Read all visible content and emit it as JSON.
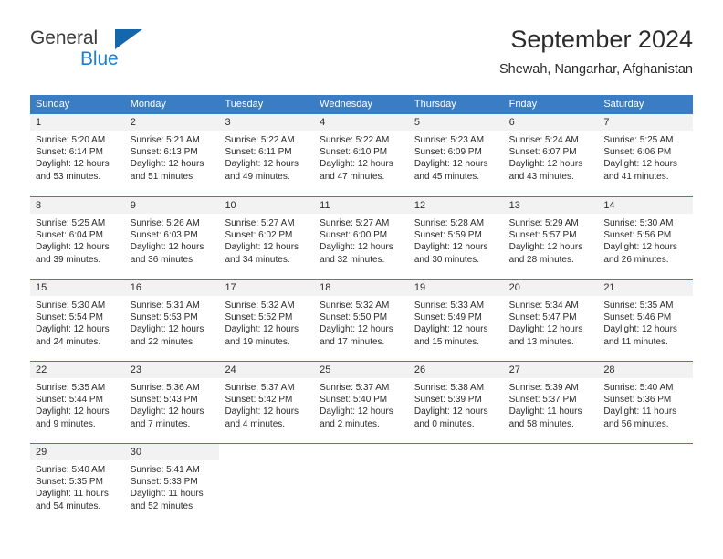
{
  "brand": {
    "name_part1": "General",
    "name_part2": "Blue",
    "logo_icon": "blue-triangle-logo"
  },
  "header": {
    "title": "September 2024",
    "location": "Shewah, Nangarhar, Afghanistan"
  },
  "colors": {
    "header_blue": "#3b7dc4",
    "brand_blue": "#1b7fd4",
    "day_number_bg": "#f2f2f2",
    "text": "#2b2b2b"
  },
  "weekdays": [
    "Sunday",
    "Monday",
    "Tuesday",
    "Wednesday",
    "Thursday",
    "Friday",
    "Saturday"
  ],
  "weeks": [
    {
      "days": [
        {
          "num": "1",
          "sunrise": "Sunrise: 5:20 AM",
          "sunset": "Sunset: 6:14 PM",
          "daylight1": "Daylight: 12 hours",
          "daylight2": "and 53 minutes."
        },
        {
          "num": "2",
          "sunrise": "Sunrise: 5:21 AM",
          "sunset": "Sunset: 6:13 PM",
          "daylight1": "Daylight: 12 hours",
          "daylight2": "and 51 minutes."
        },
        {
          "num": "3",
          "sunrise": "Sunrise: 5:22 AM",
          "sunset": "Sunset: 6:11 PM",
          "daylight1": "Daylight: 12 hours",
          "daylight2": "and 49 minutes."
        },
        {
          "num": "4",
          "sunrise": "Sunrise: 5:22 AM",
          "sunset": "Sunset: 6:10 PM",
          "daylight1": "Daylight: 12 hours",
          "daylight2": "and 47 minutes."
        },
        {
          "num": "5",
          "sunrise": "Sunrise: 5:23 AM",
          "sunset": "Sunset: 6:09 PM",
          "daylight1": "Daylight: 12 hours",
          "daylight2": "and 45 minutes."
        },
        {
          "num": "6",
          "sunrise": "Sunrise: 5:24 AM",
          "sunset": "Sunset: 6:07 PM",
          "daylight1": "Daylight: 12 hours",
          "daylight2": "and 43 minutes."
        },
        {
          "num": "7",
          "sunrise": "Sunrise: 5:25 AM",
          "sunset": "Sunset: 6:06 PM",
          "daylight1": "Daylight: 12 hours",
          "daylight2": "and 41 minutes."
        }
      ]
    },
    {
      "days": [
        {
          "num": "8",
          "sunrise": "Sunrise: 5:25 AM",
          "sunset": "Sunset: 6:04 PM",
          "daylight1": "Daylight: 12 hours",
          "daylight2": "and 39 minutes."
        },
        {
          "num": "9",
          "sunrise": "Sunrise: 5:26 AM",
          "sunset": "Sunset: 6:03 PM",
          "daylight1": "Daylight: 12 hours",
          "daylight2": "and 36 minutes."
        },
        {
          "num": "10",
          "sunrise": "Sunrise: 5:27 AM",
          "sunset": "Sunset: 6:02 PM",
          "daylight1": "Daylight: 12 hours",
          "daylight2": "and 34 minutes."
        },
        {
          "num": "11",
          "sunrise": "Sunrise: 5:27 AM",
          "sunset": "Sunset: 6:00 PM",
          "daylight1": "Daylight: 12 hours",
          "daylight2": "and 32 minutes."
        },
        {
          "num": "12",
          "sunrise": "Sunrise: 5:28 AM",
          "sunset": "Sunset: 5:59 PM",
          "daylight1": "Daylight: 12 hours",
          "daylight2": "and 30 minutes."
        },
        {
          "num": "13",
          "sunrise": "Sunrise: 5:29 AM",
          "sunset": "Sunset: 5:57 PM",
          "daylight1": "Daylight: 12 hours",
          "daylight2": "and 28 minutes."
        },
        {
          "num": "14",
          "sunrise": "Sunrise: 5:30 AM",
          "sunset": "Sunset: 5:56 PM",
          "daylight1": "Daylight: 12 hours",
          "daylight2": "and 26 minutes."
        }
      ]
    },
    {
      "days": [
        {
          "num": "15",
          "sunrise": "Sunrise: 5:30 AM",
          "sunset": "Sunset: 5:54 PM",
          "daylight1": "Daylight: 12 hours",
          "daylight2": "and 24 minutes."
        },
        {
          "num": "16",
          "sunrise": "Sunrise: 5:31 AM",
          "sunset": "Sunset: 5:53 PM",
          "daylight1": "Daylight: 12 hours",
          "daylight2": "and 22 minutes."
        },
        {
          "num": "17",
          "sunrise": "Sunrise: 5:32 AM",
          "sunset": "Sunset: 5:52 PM",
          "daylight1": "Daylight: 12 hours",
          "daylight2": "and 19 minutes."
        },
        {
          "num": "18",
          "sunrise": "Sunrise: 5:32 AM",
          "sunset": "Sunset: 5:50 PM",
          "daylight1": "Daylight: 12 hours",
          "daylight2": "and 17 minutes."
        },
        {
          "num": "19",
          "sunrise": "Sunrise: 5:33 AM",
          "sunset": "Sunset: 5:49 PM",
          "daylight1": "Daylight: 12 hours",
          "daylight2": "and 15 minutes."
        },
        {
          "num": "20",
          "sunrise": "Sunrise: 5:34 AM",
          "sunset": "Sunset: 5:47 PM",
          "daylight1": "Daylight: 12 hours",
          "daylight2": "and 13 minutes."
        },
        {
          "num": "21",
          "sunrise": "Sunrise: 5:35 AM",
          "sunset": "Sunset: 5:46 PM",
          "daylight1": "Daylight: 12 hours",
          "daylight2": "and 11 minutes."
        }
      ]
    },
    {
      "days": [
        {
          "num": "22",
          "sunrise": "Sunrise: 5:35 AM",
          "sunset": "Sunset: 5:44 PM",
          "daylight1": "Daylight: 12 hours",
          "daylight2": "and 9 minutes."
        },
        {
          "num": "23",
          "sunrise": "Sunrise: 5:36 AM",
          "sunset": "Sunset: 5:43 PM",
          "daylight1": "Daylight: 12 hours",
          "daylight2": "and 7 minutes."
        },
        {
          "num": "24",
          "sunrise": "Sunrise: 5:37 AM",
          "sunset": "Sunset: 5:42 PM",
          "daylight1": "Daylight: 12 hours",
          "daylight2": "and 4 minutes."
        },
        {
          "num": "25",
          "sunrise": "Sunrise: 5:37 AM",
          "sunset": "Sunset: 5:40 PM",
          "daylight1": "Daylight: 12 hours",
          "daylight2": "and 2 minutes."
        },
        {
          "num": "26",
          "sunrise": "Sunrise: 5:38 AM",
          "sunset": "Sunset: 5:39 PM",
          "daylight1": "Daylight: 12 hours",
          "daylight2": "and 0 minutes."
        },
        {
          "num": "27",
          "sunrise": "Sunrise: 5:39 AM",
          "sunset": "Sunset: 5:37 PM",
          "daylight1": "Daylight: 11 hours",
          "daylight2": "and 58 minutes."
        },
        {
          "num": "28",
          "sunrise": "Sunrise: 5:40 AM",
          "sunset": "Sunset: 5:36 PM",
          "daylight1": "Daylight: 11 hours",
          "daylight2": "and 56 minutes."
        }
      ]
    },
    {
      "days": [
        {
          "num": "29",
          "sunrise": "Sunrise: 5:40 AM",
          "sunset": "Sunset: 5:35 PM",
          "daylight1": "Daylight: 11 hours",
          "daylight2": "and 54 minutes."
        },
        {
          "num": "30",
          "sunrise": "Sunrise: 5:41 AM",
          "sunset": "Sunset: 5:33 PM",
          "daylight1": "Daylight: 11 hours",
          "daylight2": "and 52 minutes."
        },
        {
          "num": "",
          "sunrise": "",
          "sunset": "",
          "daylight1": "",
          "daylight2": ""
        },
        {
          "num": "",
          "sunrise": "",
          "sunset": "",
          "daylight1": "",
          "daylight2": ""
        },
        {
          "num": "",
          "sunrise": "",
          "sunset": "",
          "daylight1": "",
          "daylight2": ""
        },
        {
          "num": "",
          "sunrise": "",
          "sunset": "",
          "daylight1": "",
          "daylight2": ""
        },
        {
          "num": "",
          "sunrise": "",
          "sunset": "",
          "daylight1": "",
          "daylight2": ""
        }
      ]
    }
  ]
}
